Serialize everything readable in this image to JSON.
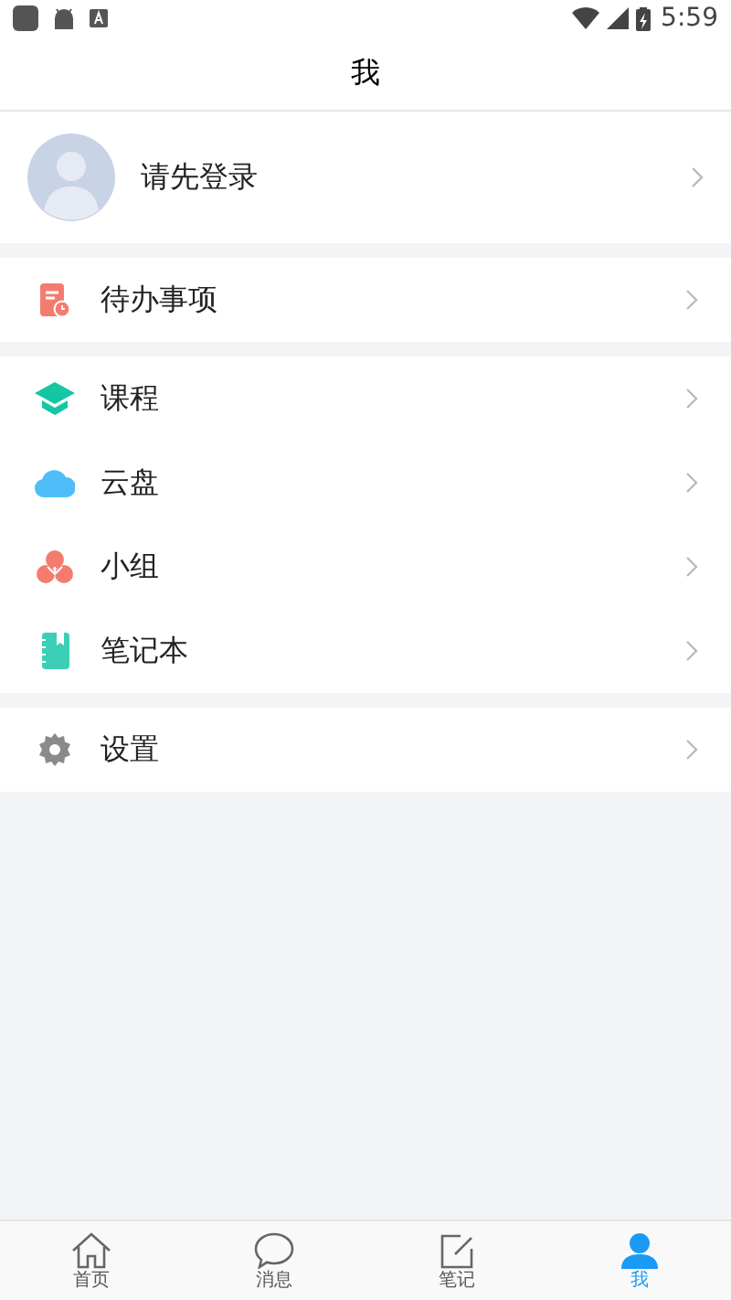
{
  "status_bar": {
    "time": "5:59"
  },
  "header": {
    "title": "我"
  },
  "profile": {
    "label": "请先登录"
  },
  "menu_groups": [
    {
      "items": [
        {
          "label": "待办事项",
          "kind": "todo"
        }
      ]
    },
    {
      "items": [
        {
          "label": "课程",
          "kind": "course"
        },
        {
          "label": "云盘",
          "kind": "cloud"
        },
        {
          "label": "小组",
          "kind": "group"
        },
        {
          "label": "笔记本",
          "kind": "notebook"
        }
      ]
    },
    {
      "items": [
        {
          "label": "设置",
          "kind": "settings"
        }
      ]
    }
  ],
  "bottom_nav": [
    {
      "label": "首页",
      "kind": "home",
      "selected": false
    },
    {
      "label": "消息",
      "kind": "message",
      "selected": false
    },
    {
      "label": "笔记",
      "kind": "note",
      "selected": false
    },
    {
      "label": "我",
      "kind": "person",
      "selected": true
    }
  ]
}
